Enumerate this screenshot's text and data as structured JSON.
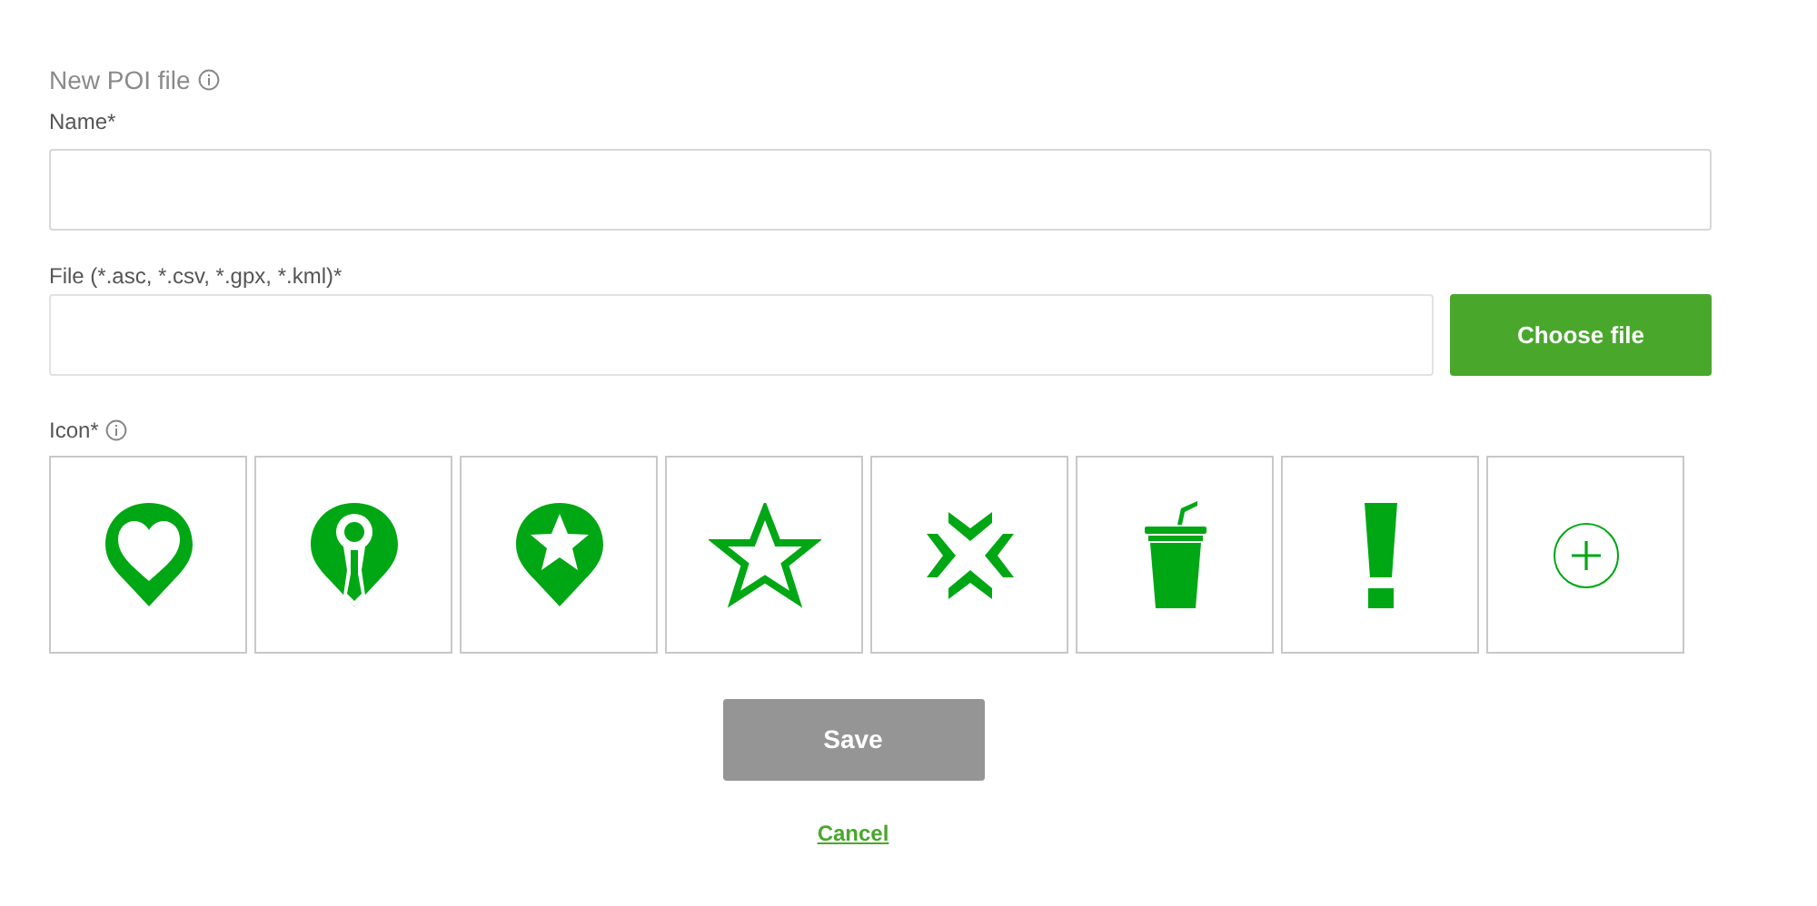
{
  "title": "New POI file",
  "name_field": {
    "label": "Name*"
  },
  "file_field": {
    "label": "File (*.asc, *.csv, *.gpx, *.kml)*",
    "button": "Choose file"
  },
  "icon_picker": {
    "label": "Icon*",
    "icons": [
      {
        "kind": "heart-pin"
      },
      {
        "kind": "ribbon-pin"
      },
      {
        "kind": "star-pin"
      },
      {
        "kind": "star"
      },
      {
        "kind": "arrows"
      },
      {
        "kind": "cup"
      },
      {
        "kind": "exclamation"
      },
      {
        "kind": "add"
      }
    ]
  },
  "save_button": {
    "label": "Save",
    "disabled": true
  },
  "cancel_link": "Cancel"
}
